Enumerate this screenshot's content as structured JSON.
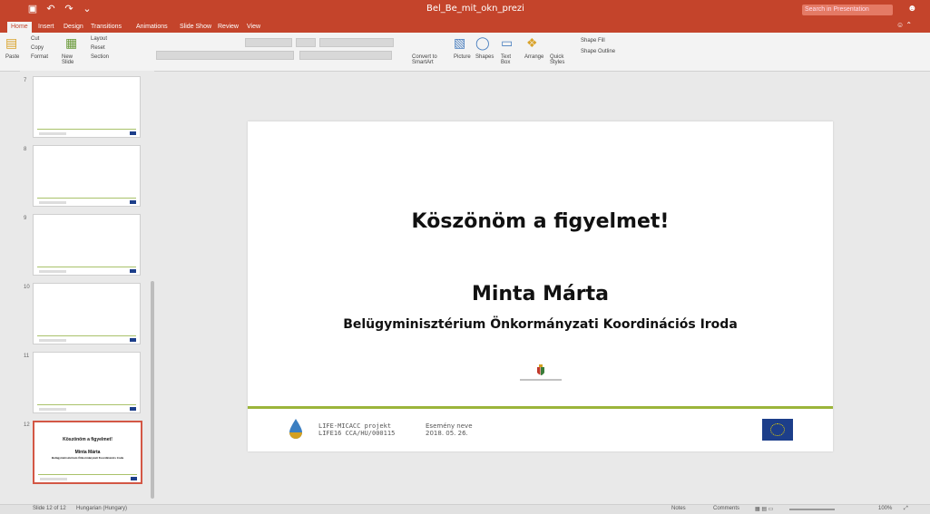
{
  "app": {
    "doc_title": "Bel_Be_mit_okn_prezi",
    "search_placeholder": "Search in Presentation"
  },
  "colors": {
    "accent": "#c4442b",
    "slide_line": "#9bb53a",
    "eu_blue": "#1c3e8a"
  },
  "qat_icons": [
    "save-icon",
    "undo-icon",
    "redo-icon",
    "customize-icon"
  ],
  "tabs": [
    "Home",
    "Insert",
    "Design",
    "Transitions",
    "Animations",
    "Slide Show",
    "Review",
    "View"
  ],
  "ribbon": {
    "paste": "Paste",
    "cut": "Cut",
    "copy": "Copy",
    "format": "Format",
    "new_slide": "New Slide",
    "layout": "Layout",
    "reset": "Reset",
    "section": "Section",
    "convert_smartart": "Convert to SmartArt",
    "picture": "Picture",
    "shapes": "Shapes",
    "text_box": "Text Box",
    "arrange": "Arrange",
    "quick_styles": "Quick Styles",
    "shape_fill": "Shape Fill",
    "shape_outline": "Shape Outline"
  },
  "thumbnails": [
    {
      "number": "7"
    },
    {
      "number": "8"
    },
    {
      "number": "9"
    },
    {
      "number": "10"
    },
    {
      "number": "11"
    },
    {
      "number": "12",
      "title": "Köszönöm a figyelmet!",
      "name": "Minta Márta",
      "org": "Belügyminisztérium Önkormányzati Koordinációs Iroda"
    }
  ],
  "slide": {
    "title": "Köszönöm a figyelmet!",
    "name": "Minta Márta",
    "org": "Belügyminisztérium Önkormányzati Koordinációs Iroda",
    "project_line1": "LIFE-MICACC projekt",
    "project_line2": "LIFE16 CCA/HU/000115",
    "event_line1": "Esemény neve",
    "event_line2": "2018. 05. 26."
  },
  "status": {
    "slide_counter": "Slide 12 of 12",
    "language": "Hungarian (Hungary)",
    "notes": "Notes",
    "comments": "Comments",
    "zoom": "100%"
  }
}
